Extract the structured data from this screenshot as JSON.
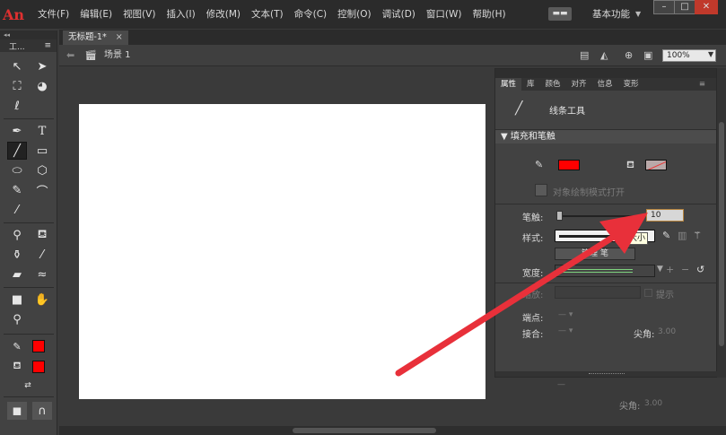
{
  "app": {
    "logo_text": "An",
    "menu": [
      "文件(F)",
      "编辑(E)",
      "视图(V)",
      "插入(I)",
      "修改(M)",
      "文本(T)",
      "命令(C)",
      "控制(O)",
      "调试(D)",
      "窗口(W)",
      "帮助(H)"
    ],
    "workspace_button": "▬▬",
    "workspace_label": "基本功能",
    "window_buttons": {
      "minimize": "–",
      "maximize": "□",
      "close": "✕"
    }
  },
  "tools_panel": {
    "header_marker": "◂◂",
    "tab_label": "工...",
    "swatches": {
      "stroke_color": "#ff0000",
      "fill_color": "#ff0000"
    }
  },
  "document": {
    "tab_title": "无标题-1*",
    "tab_close": "×",
    "scene_label": "场景 1",
    "zoom_value": "100%",
    "stage_color": "#ffffff"
  },
  "properties": {
    "tabs": [
      "属性",
      "库",
      "颜色",
      "对齐",
      "信息",
      "变形"
    ],
    "active_tab": "属性",
    "tool_name": "线条工具",
    "section_fill_stroke": "填充和笔触",
    "object_draw_mode": "对象绘制模式打开",
    "stroke_label": "笔触:",
    "stroke_value": "10",
    "style_label": "样式:",
    "tooltip_text": "大小",
    "manage_button": "管理",
    "manage_button_tail": "笔",
    "width_label": "宽度:",
    "zoom_label": "缩放:",
    "hint_label": "提示",
    "cap_label": "端点:",
    "join_label": "接合:",
    "miter_label": "尖角:",
    "miter_value": "3.00",
    "ghost_miter_label": "尖角:",
    "ghost_miter_value": "3.00"
  },
  "colors": {
    "accent_red": "#ff0000",
    "annotation_arrow": "#e8303a"
  }
}
